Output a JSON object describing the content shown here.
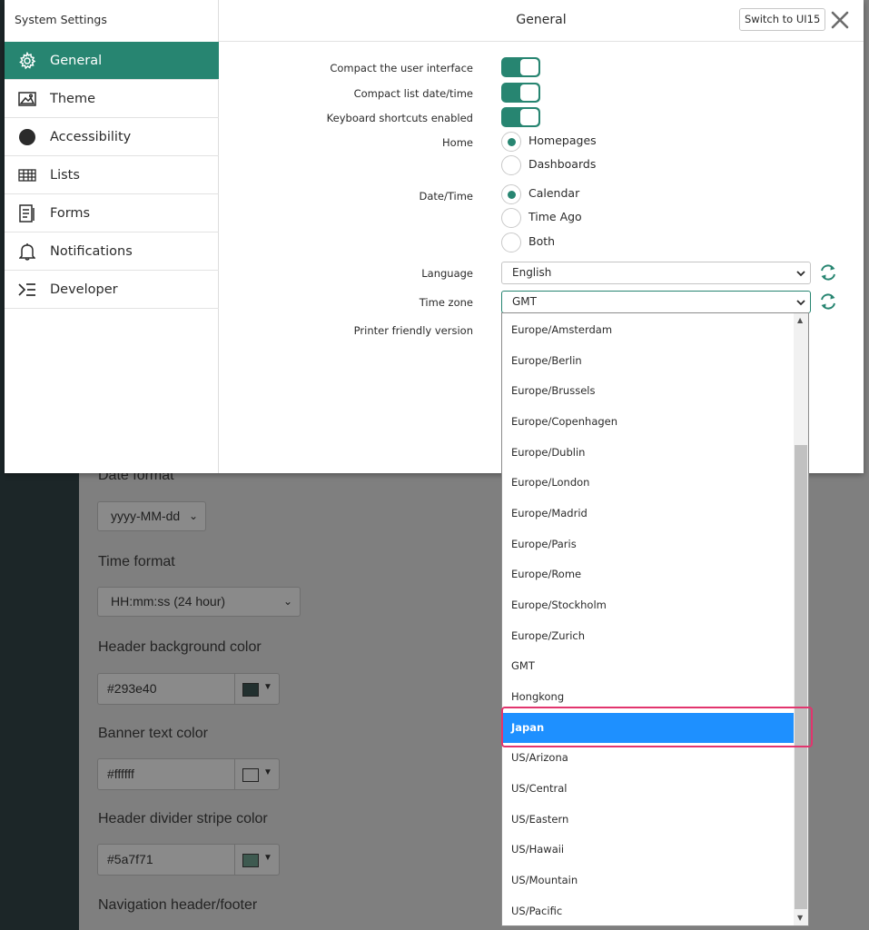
{
  "background": {
    "date_format_label": "Date format",
    "date_format_value": "yyyy-MM-dd",
    "time_format_label": "Time format",
    "time_format_value": "HH:mm:ss (24 hour)",
    "header_bg_label": "Header background color",
    "header_bg_value": "#293e40",
    "banner_text_label": "Banner text color",
    "banner_text_value": "#ffffff",
    "divider_label": "Header divider stripe color",
    "divider_value": "#5a7f71",
    "nav_label": "Navigation header/footer"
  },
  "sidebar": {
    "title": "System Settings",
    "items": [
      {
        "label": "General",
        "icon": "gear-icon",
        "active": true
      },
      {
        "label": "Theme",
        "icon": "image-icon",
        "active": false
      },
      {
        "label": "Accessibility",
        "icon": "circle-icon",
        "active": false
      },
      {
        "label": "Lists",
        "icon": "list-grid-icon",
        "active": false
      },
      {
        "label": "Forms",
        "icon": "form-icon",
        "active": false
      },
      {
        "label": "Notifications",
        "icon": "bell-icon",
        "active": false
      },
      {
        "label": "Developer",
        "icon": "developer-icon",
        "active": false
      }
    ]
  },
  "header": {
    "title": "General",
    "switch_label": "Switch to UI15"
  },
  "form": {
    "compact_ui_label": "Compact the user interface",
    "compact_list_label": "Compact list date/time",
    "keyboard_label": "Keyboard shortcuts enabled",
    "home_label": "Home",
    "home_options": [
      "Homepages",
      "Dashboards"
    ],
    "home_selected": "Homepages",
    "datetime_label": "Date/Time",
    "datetime_options": [
      "Calendar",
      "Time Ago",
      "Both"
    ],
    "datetime_selected": "Calendar",
    "language_label": "Language",
    "language_value": "English",
    "timezone_label": "Time zone",
    "timezone_value": "GMT",
    "printer_label": "Printer friendly version"
  },
  "dropdown": {
    "options": [
      "Europe/Amsterdam",
      "Europe/Berlin",
      "Europe/Brussels",
      "Europe/Copenhagen",
      "Europe/Dublin",
      "Europe/London",
      "Europe/Madrid",
      "Europe/Paris",
      "Europe/Rome",
      "Europe/Stockholm",
      "Europe/Zurich",
      "GMT",
      "Hongkong",
      "Japan",
      "US/Arizona",
      "US/Central",
      "US/Eastern",
      "US/Hawaii",
      "US/Mountain",
      "US/Pacific"
    ],
    "highlighted": "Japan"
  },
  "colors": {
    "accent": "#278571",
    "highlight_blue": "#1e90ff",
    "annotation": "#e2356e"
  }
}
